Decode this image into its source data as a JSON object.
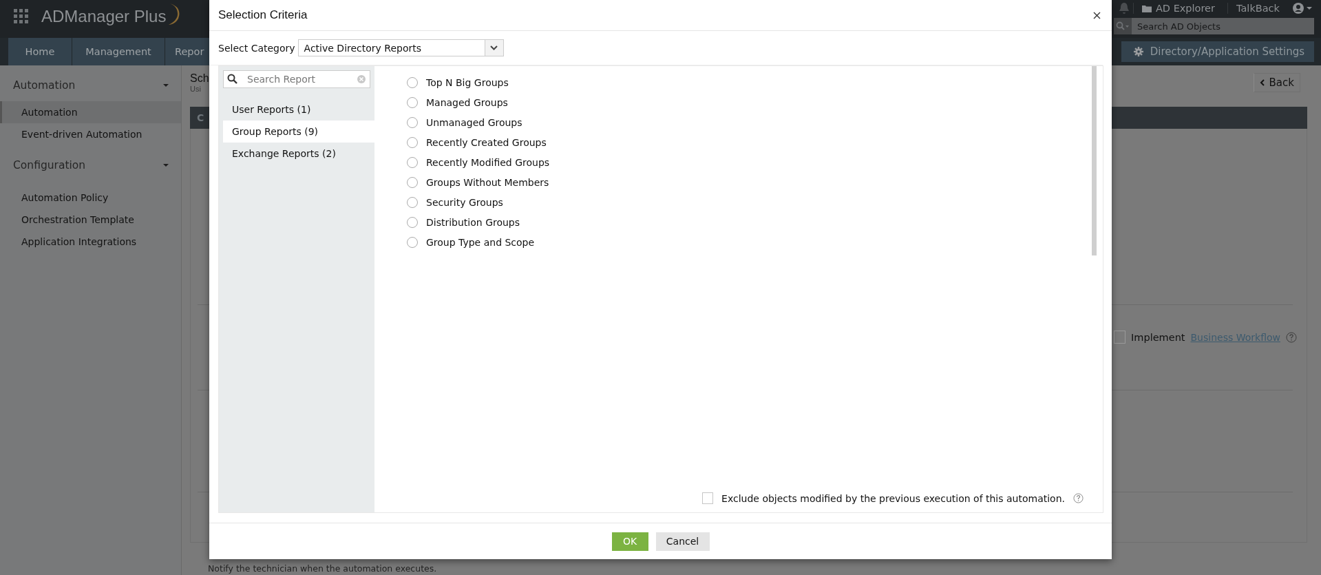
{
  "app": {
    "name": "ADManager Plus"
  },
  "header_links": [
    {
      "label": "AD Explorer",
      "kind": "folder"
    },
    {
      "label": "TalkBack",
      "kind": "plain"
    }
  ],
  "search": {
    "placeholder": "Search AD Objects"
  },
  "nav_tabs": [
    {
      "label": "Home",
      "selected": false
    },
    {
      "label": "Management",
      "selected": false
    },
    {
      "label": "Repor",
      "selected": false
    }
  ],
  "settings_button": "Directory/Application Settings",
  "sidebar": {
    "sections": [
      {
        "title": "Automation",
        "expanded": true,
        "items": [
          {
            "label": "Automation",
            "selected": true
          },
          {
            "label": "Event-driven Automation",
            "selected": false
          }
        ]
      },
      {
        "title": "Configuration",
        "expanded": true,
        "items": [
          {
            "label": "Automation Policy",
            "selected": false
          },
          {
            "label": "Orchestration Template",
            "selected": false
          },
          {
            "label": "Application Integrations",
            "selected": false
          }
        ]
      }
    ]
  },
  "page": {
    "title": "Sch",
    "subtitle": "Usi",
    "back_button": "Back",
    "section_bar": "C",
    "implement": {
      "checked": false,
      "label": "Implement",
      "link": "Business Workflow"
    },
    "footer_note": "Notify the technician when the automation executes."
  },
  "dialog": {
    "title": "Selection Criteria",
    "category_label": "Select Category",
    "category_value": "Active Directory Reports",
    "search_placeholder": "Search Report",
    "categories": [
      {
        "label": "User Reports (1)",
        "selected": false
      },
      {
        "label": "Group Reports (9)",
        "selected": true
      },
      {
        "label": "Exchange Reports (2)",
        "selected": false
      }
    ],
    "reports": [
      {
        "label": "Top N Big Groups",
        "selected": false
      },
      {
        "label": "Managed Groups",
        "selected": false
      },
      {
        "label": "Unmanaged Groups",
        "selected": false
      },
      {
        "label": "Recently Created Groups",
        "selected": false
      },
      {
        "label": "Recently Modified Groups",
        "selected": false
      },
      {
        "label": "Groups Without Members",
        "selected": false
      },
      {
        "label": "Security Groups",
        "selected": false
      },
      {
        "label": "Distribution Groups",
        "selected": false
      },
      {
        "label": "Group Type and Scope",
        "selected": false
      }
    ],
    "exclude": {
      "checked": false,
      "label": "Exclude objects modified by the previous execution of this automation."
    },
    "buttons": [
      {
        "label": "OK",
        "kind": "primary"
      },
      {
        "label": "Cancel",
        "kind": "secondary"
      }
    ]
  }
}
